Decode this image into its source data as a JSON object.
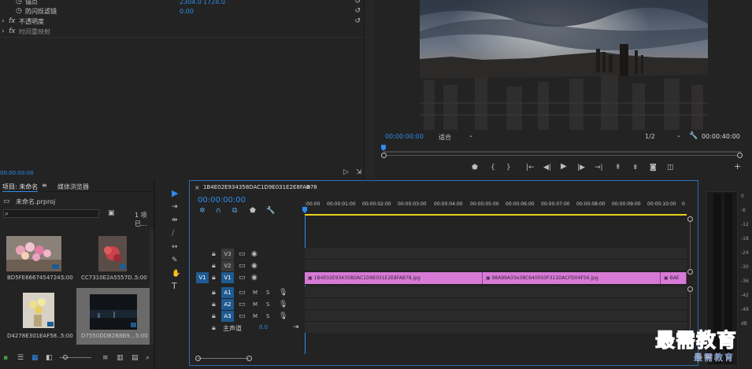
{
  "effect_controls": {
    "rows": [
      {
        "label": "锚点",
        "val1": "2304.0",
        "val2": "1728.0"
      },
      {
        "label": "防闪烁滤镜",
        "val1": "0.00"
      },
      {
        "label": "不透明度"
      },
      {
        "label": "时间重映射"
      }
    ],
    "timecode": "00:00:00:00"
  },
  "program": {
    "timecode_left": "00:00:00:00",
    "fit": "适合",
    "resolution": "1/2",
    "timecode_right": "00:00:40:00"
  },
  "project": {
    "tab_project": "项目: 未命名",
    "tab_media": "媒体浏览器",
    "file": "未命名.prproj",
    "count": "1 项已...",
    "items": [
      {
        "name": "BD5FE6667454724...",
        "duration": "5:00"
      },
      {
        "name": "CC7310E2A5557D...",
        "duration": "5:00"
      },
      {
        "name": "D4278E301EAF58...",
        "duration": "5:00"
      },
      {
        "name": "D7550DDB2B8B9...",
        "duration": "5:00"
      }
    ]
  },
  "timeline": {
    "tab_name": "1B4E02E934358DAC1D9E031E2E8FAB78",
    "timecode": "00:00:00:00",
    "ruler": [
      ":00:00",
      "00:00:01:00",
      "00:00:02:00",
      "00:00:03:00",
      "00:00:04:00",
      "00:00:05:00",
      "00:00:06:00",
      "00:00:07:00",
      "00:00:08:00",
      "00:00:09:00",
      "00:00:10:00",
      "0"
    ],
    "video_tracks": [
      "V3",
      "V2",
      "V1"
    ],
    "audio_tracks": [
      "A1",
      "A2",
      "A3"
    ],
    "source_v1": "V1",
    "master_label": "主声道",
    "master_value": "0.0",
    "mute": "M",
    "solo": "S",
    "clips": [
      "1B4E02E934358DAC1D9E031E2E8FAB78.jpg",
      "98A99A33e38C640050F311DACFD04F56.jpg",
      "BAE"
    ]
  },
  "meter": {
    "ticks": [
      "0",
      "-6",
      "-12",
      "-18",
      "-24",
      "-30",
      "-36",
      "-42",
      "-48",
      "dB"
    ]
  },
  "watermark": {
    "big": "最需教育",
    "small": "最需教育"
  }
}
